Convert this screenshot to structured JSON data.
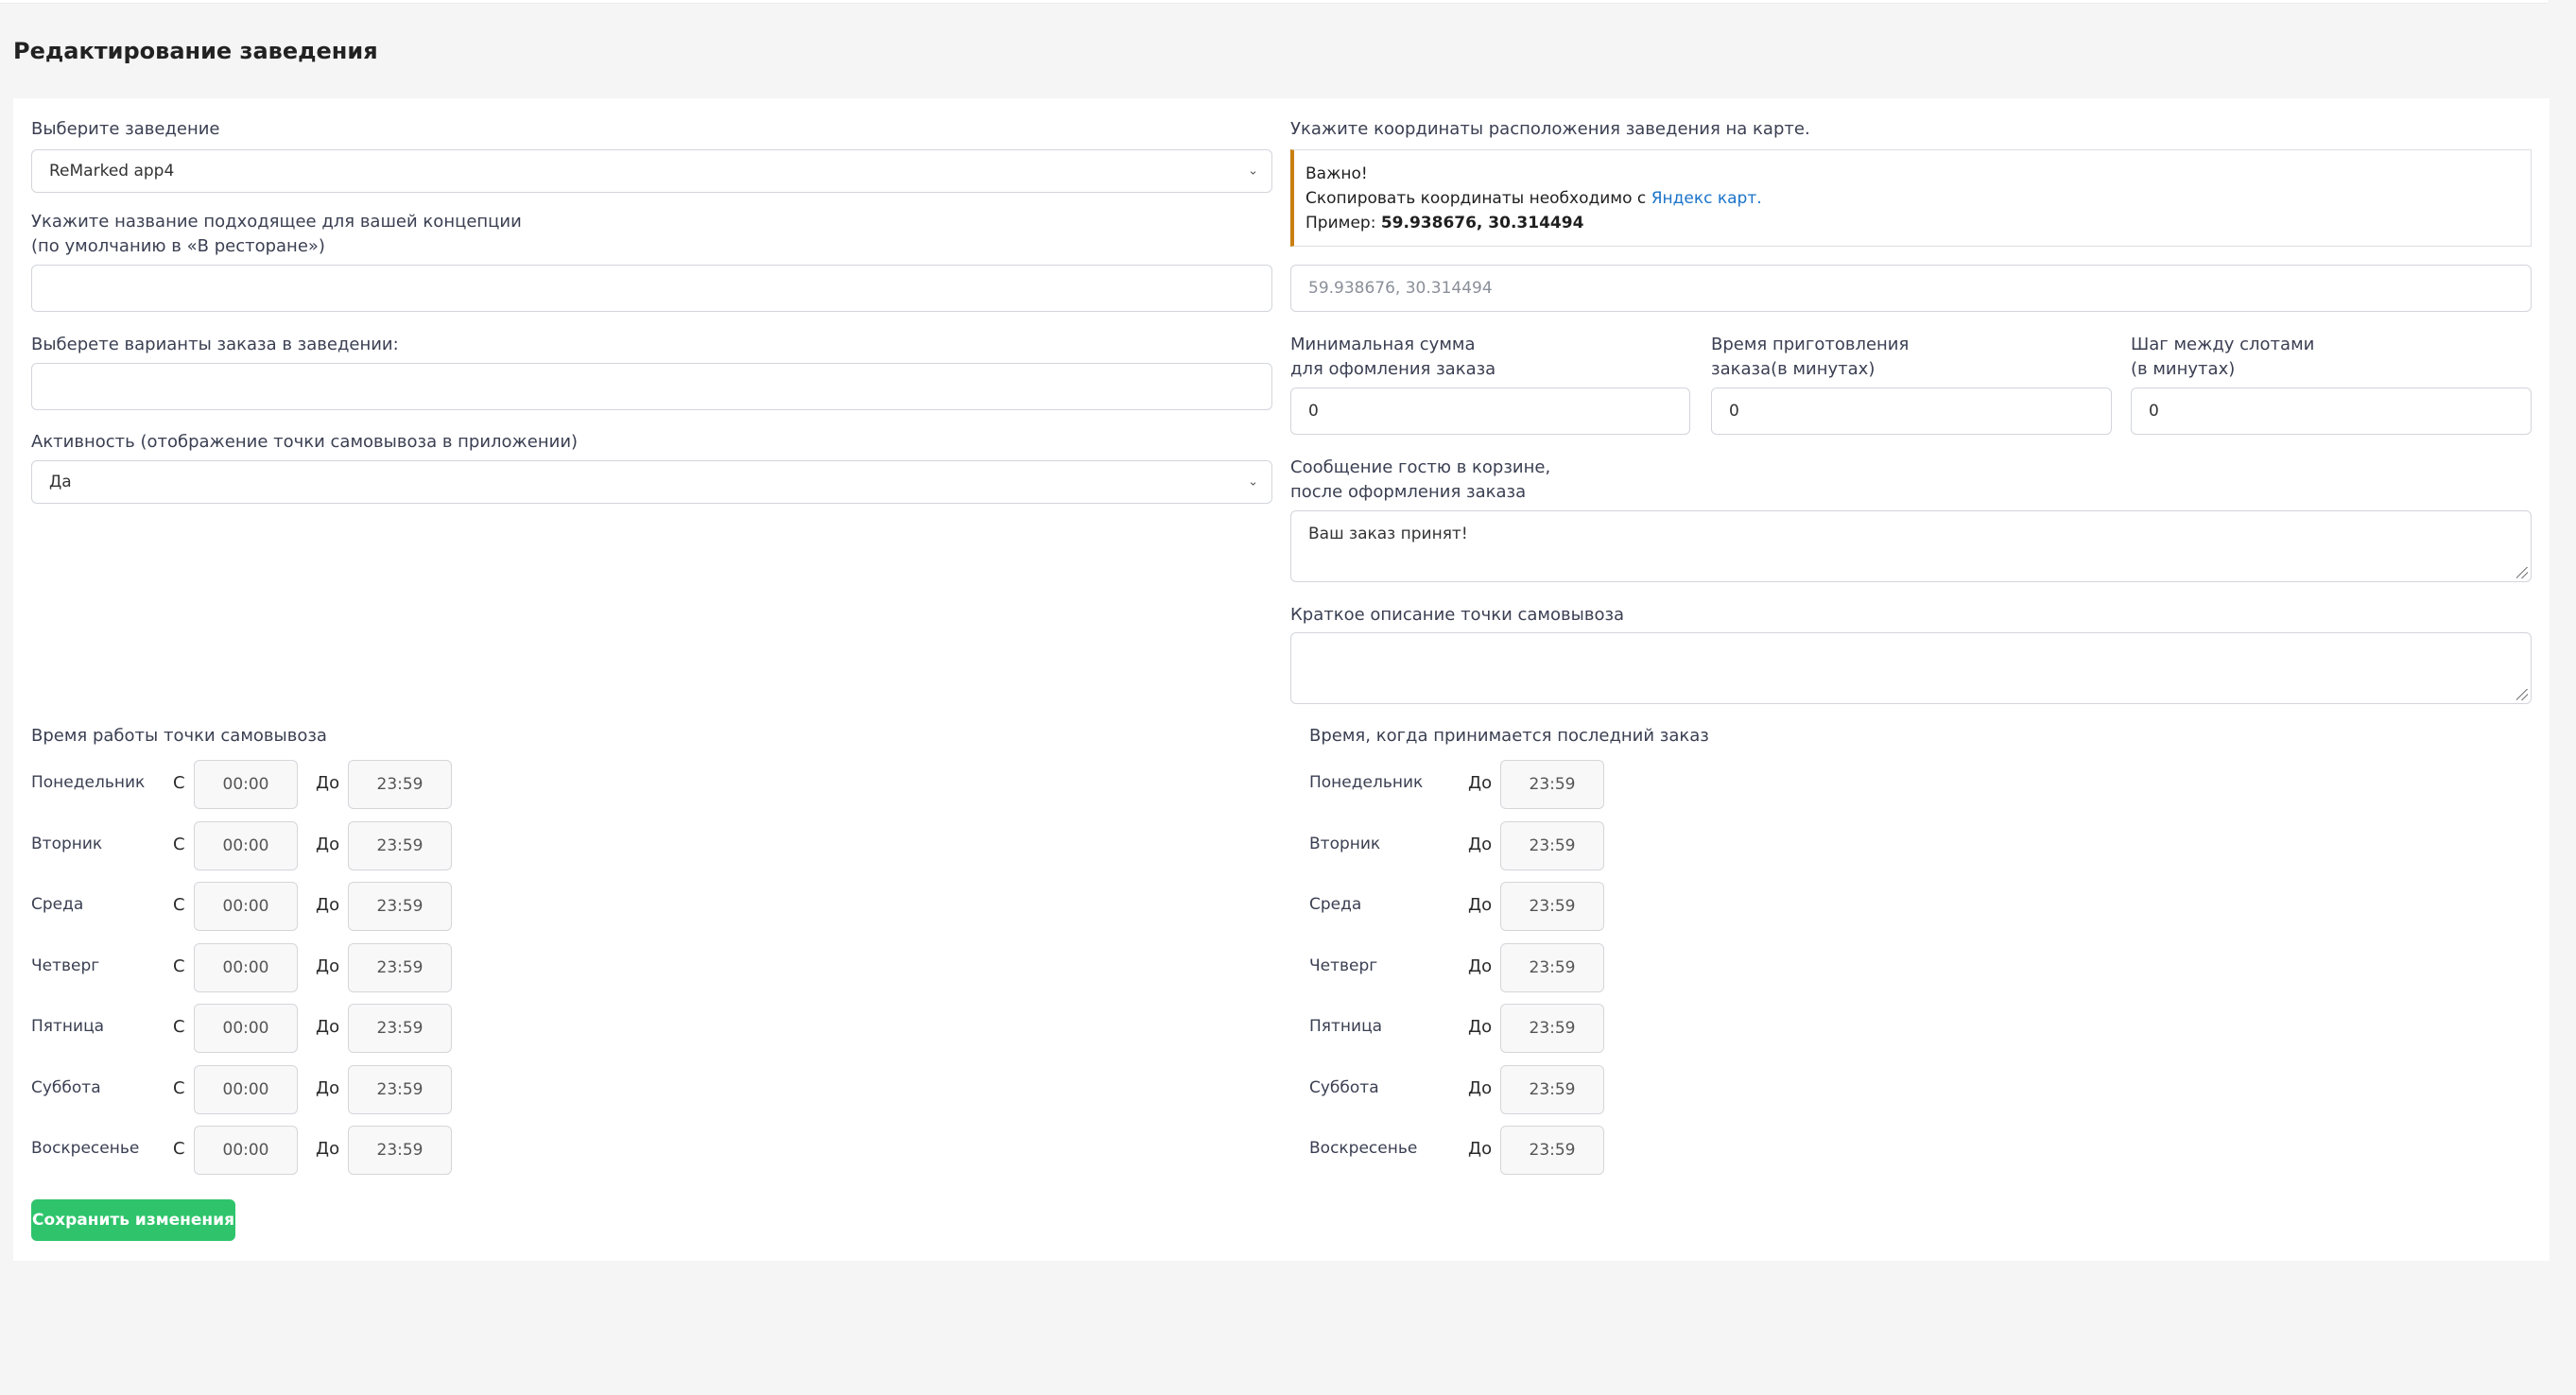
{
  "page": {
    "title": "Редактирование заведения"
  },
  "left": {
    "venue_label": "Выберите заведение",
    "venue_value": "ReMarked app4",
    "concept_label_line1": "Укажите название подходящее для вашей концепции",
    "concept_label_line2": "(по умолчанию в «В ресторане»)",
    "concept_value": "",
    "order_types_label": "Выберете варианты заказа в заведении:",
    "order_types_value": "",
    "activity_label": "Активность (отображение точки самовывоза в приложении)",
    "activity_value": "Да"
  },
  "right": {
    "coords_label": "Укажите координаты расположения заведения на карте.",
    "alert": {
      "title": "Важно!",
      "text_prefix": "Скопировать координаты необходимо с ",
      "link": "Яндекс карт.",
      "example_prefix": "Пример: ",
      "example_value": "59.938676, 30.314494"
    },
    "coords_placeholder": "59.938676, 30.314494",
    "min_sum_label_line1": "Минимальная сумма",
    "min_sum_label_line2": "для офомления заказа",
    "min_sum_value": "0",
    "prep_time_label_line1": "Время приготовления",
    "prep_time_label_line2": "заказа(в минутах)",
    "prep_time_value": "0",
    "slot_step_label_line1": "Шаг между слотами",
    "slot_step_label_line2": "(в минутах)",
    "slot_step_value": "0",
    "guest_msg_label_line1": "Сообщение гостю в корзине,",
    "guest_msg_label_line2": "после оформления заказа",
    "guest_msg_value": "Ваш заказ принят!",
    "short_desc_label": "Краткое описание точки самовывоза",
    "short_desc_value": ""
  },
  "schedule": {
    "hours_title": "Время работы точки самовывоза",
    "last_order_title": "Время, когда принимается последний заказ",
    "from_label": "С",
    "to_label": "До",
    "days": [
      {
        "name": "Понедельник",
        "from": "00:00",
        "to": "23:59",
        "last": "23:59"
      },
      {
        "name": "Вторник",
        "from": "00:00",
        "to": "23:59",
        "last": "23:59"
      },
      {
        "name": "Среда",
        "from": "00:00",
        "to": "23:59",
        "last": "23:59"
      },
      {
        "name": "Четверг",
        "from": "00:00",
        "to": "23:59",
        "last": "23:59"
      },
      {
        "name": "Пятница",
        "from": "00:00",
        "to": "23:59",
        "last": "23:59"
      },
      {
        "name": "Суббота",
        "from": "00:00",
        "to": "23:59",
        "last": "23:59"
      },
      {
        "name": "Воскресенье",
        "from": "00:00",
        "to": "23:59",
        "last": "23:59"
      }
    ]
  },
  "actions": {
    "save_label": "Сохранить изменения"
  },
  "colors": {
    "save_button": "#2fc46c",
    "alert_accent": "#c87f10",
    "link": "#1a73c9"
  },
  "icons": {
    "select_chevron": "chevron-down-icon",
    "textarea_resize": "resize-grip-icon"
  }
}
